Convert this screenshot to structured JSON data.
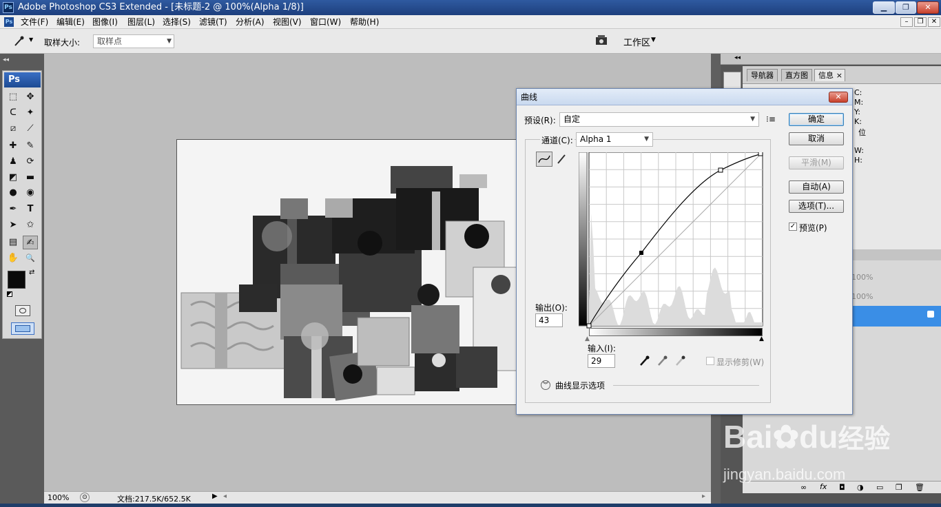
{
  "window": {
    "title": "Adobe Photoshop CS3 Extended - [未标题-2 @ 100%(Alpha 1/8)]",
    "app_badge": "Ps",
    "btn_min": "▁",
    "btn_restore": "❐",
    "btn_close": "✕"
  },
  "menu": {
    "items": [
      "文件(F)",
      "编辑(E)",
      "图像(I)",
      "图层(L)",
      "选择(S)",
      "滤镜(T)",
      "分析(A)",
      "视图(V)",
      "窗口(W)",
      "帮助(H)"
    ],
    "doc_min": "–",
    "doc_restore": "❐",
    "doc_close": "✕"
  },
  "options": {
    "sample_size_label": "取样大小:",
    "sample_size_value": "取样点",
    "workspace_label": "工作区",
    "workspace_arrow": "▼"
  },
  "toolbox": {
    "logo": "Ps",
    "tools": [
      "⬚",
      "✥",
      "ᑕ",
      "✦",
      "⧄",
      "⟋",
      "✚",
      "✎",
      "♟",
      "⟳",
      "◩",
      "▬",
      "●",
      "◉",
      "✒",
      "T",
      "➤",
      "✩",
      "▤",
      "✍",
      "✋",
      "🔍"
    ]
  },
  "status": {
    "zoom": "100%",
    "doc_size": "文档:217.5K/652.5K",
    "arrow": "▶",
    "scroll_left": "◂",
    "scroll_right": "▸"
  },
  "panels": {
    "tabs": [
      "导航器",
      "直方图",
      "信息"
    ],
    "tab_close": "×",
    "info_labels": [
      "C:",
      "M:",
      "Y:",
      "K:",
      "位",
      "W:",
      "H:"
    ],
    "layer_opacity": "100%",
    "layer_fill": "100%"
  },
  "dialog": {
    "title": "曲线",
    "close": "✕",
    "preset_label": "预设(R):",
    "preset_value": "自定",
    "channel_label": "通道(C):",
    "channel_value": "Alpha 1",
    "output_label": "输出(O):",
    "output_value": "43",
    "input_label": "输入(I):",
    "input_value": "29",
    "clip_label": "显示修剪(W)",
    "options_label": "曲线显示选项",
    "buttons": {
      "ok": "确定",
      "cancel": "取消",
      "smooth": "平滑(M)",
      "auto": "自动(A)",
      "options": "选项(T)..."
    },
    "preview_label": "预览(P)",
    "preview_checked": "✓"
  },
  "watermark": {
    "brand": "Bai",
    "brand2": "du",
    "brand3": "经验",
    "url": "jingyan.baidu.com"
  },
  "colors": {
    "titlebar": "#2f5aa0",
    "selection": "#3a8ee6",
    "dialog_bg": "#f0f0f0"
  }
}
